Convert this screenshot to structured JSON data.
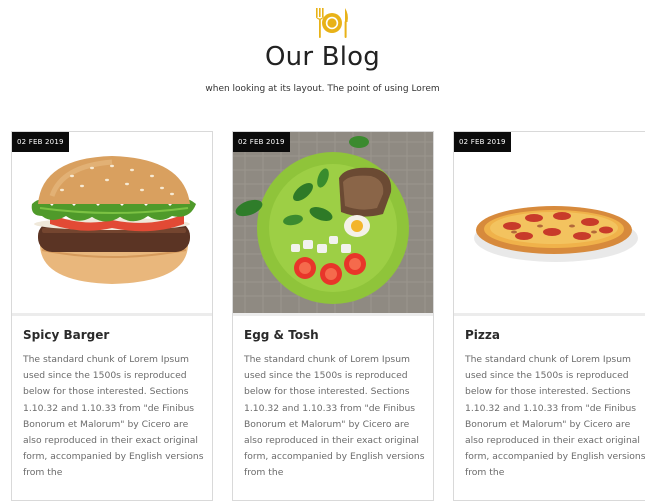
{
  "header": {
    "title": "Our Blog",
    "subtitle": "when looking at its layout. The point of using Lorem",
    "logo_icon": "plate-fork-knife-icon",
    "accent_color": "#e8b218"
  },
  "posts": [
    {
      "date": "02 FEB 2019",
      "title": "Spicy Barger",
      "image": "burger-image",
      "text": "The standard chunk of Lorem Ipsum used since the 1500s is reproduced below for those interested. Sections 1.10.32 and 1.10.33 from \"de Finibus Bonorum et Malorum\" by Cicero are also reproduced in their exact original form, accompanied by English versions from the"
    },
    {
      "date": "02 FEB 2019",
      "title": "Egg & Tosh",
      "image": "egg-toast-salad-image",
      "text": "The standard chunk of Lorem Ipsum used since the 1500s is reproduced below for those interested. Sections 1.10.32 and 1.10.33 from \"de Finibus Bonorum et Malorum\" by Cicero are also reproduced in their exact original form, accompanied by English versions from the"
    },
    {
      "date": "02 FEB 2019",
      "title": "Pizza",
      "image": "pizza-image",
      "text": "The standard chunk of Lorem Ipsum used since the 1500s is reproduced below for those interested. Sections 1.10.32 and 1.10.33 from \"de Finibus Bonorum et Malorum\" by Cicero are also reproduced in their exact original form, accompanied by English versions from the"
    }
  ]
}
